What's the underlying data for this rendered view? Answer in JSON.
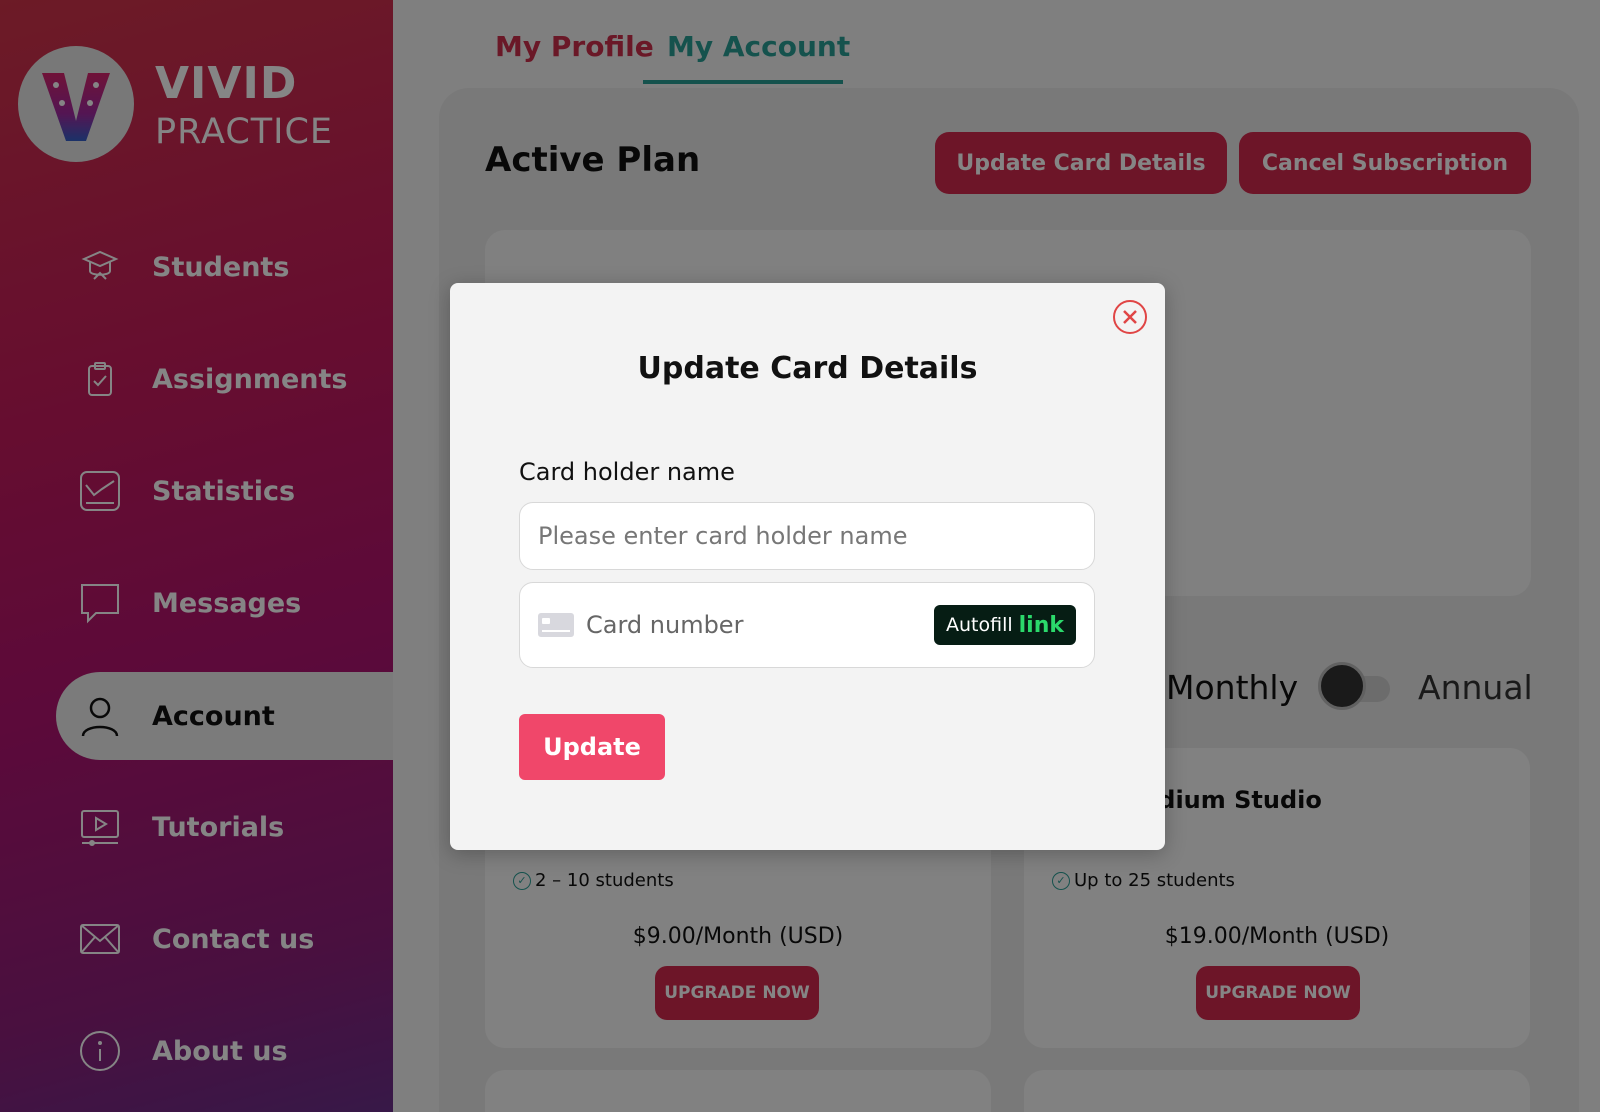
{
  "app": {
    "logo_line1": "VIVID",
    "logo_line2": "PRACTICE"
  },
  "sidebar": {
    "items": [
      {
        "label": "Students",
        "icon": "graduation-cap-icon"
      },
      {
        "label": "Assignments",
        "icon": "clipboard-check-icon"
      },
      {
        "label": "Statistics",
        "icon": "chart-icon"
      },
      {
        "label": "Messages",
        "icon": "message-bubble-icon"
      },
      {
        "label": "Account",
        "icon": "user-icon",
        "active": true
      },
      {
        "label": "Tutorials",
        "icon": "video-icon"
      },
      {
        "label": "Contact us",
        "icon": "envelope-icon"
      },
      {
        "label": "About us",
        "icon": "info-icon"
      }
    ]
  },
  "tabs": {
    "profile": "My Profile",
    "account": "My Account"
  },
  "main": {
    "active_plan_title": "Active Plan",
    "update_card_button": "Update Card Details",
    "cancel_subscription_button": "Cancel Subscription",
    "billing": {
      "monthly": "Monthly",
      "annual": "Annual"
    },
    "cards": [
      {
        "title": "",
        "feature": "2 – 10 students",
        "price": "$9.00/Month (USD)",
        "button": "UPGRADE NOW"
      },
      {
        "title": "edium Studio",
        "feature": "Up to 25 students",
        "price": "$19.00/Month (USD)",
        "button": "UPGRADE NOW"
      }
    ]
  },
  "modal": {
    "title": "Update Card Details",
    "name_label": "Card holder name",
    "name_placeholder": "Please enter card holder name",
    "card_number_placeholder": "Card number",
    "autofill_text": "Autofill",
    "autofill_link": "link",
    "update_button": "Update"
  },
  "colors": {
    "accent_red": "#d22a4d",
    "accent_teal": "#2a9d95",
    "update_button": "#f0476a"
  }
}
